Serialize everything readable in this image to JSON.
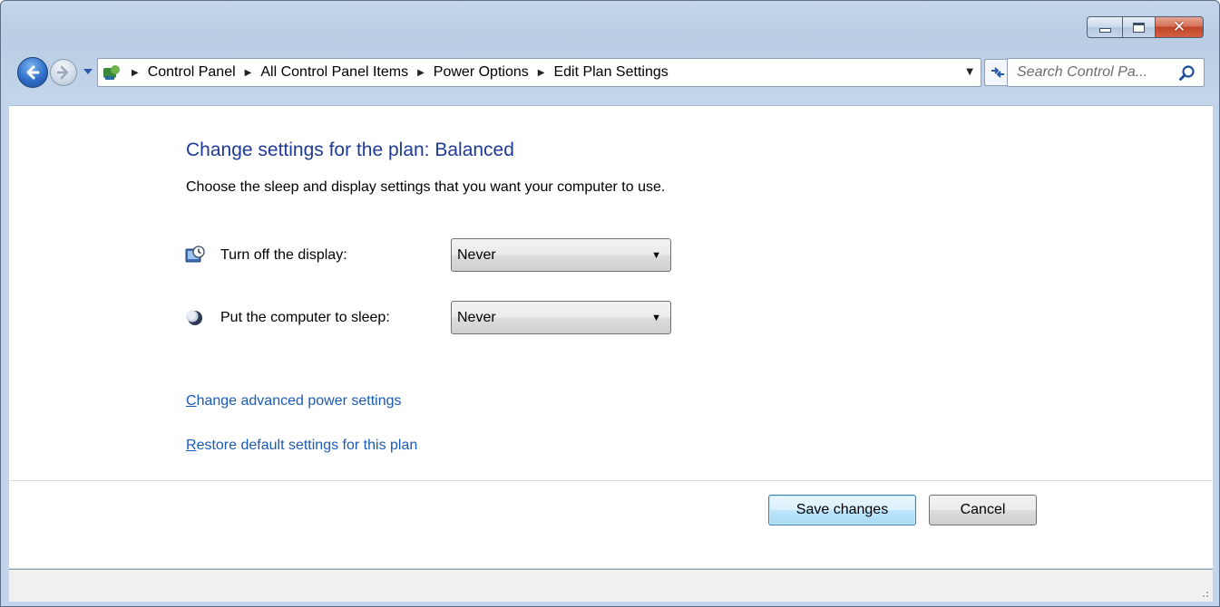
{
  "window": {
    "caption": {
      "minimize_label": "Minimize",
      "maximize_label": "Maximize",
      "close_label": "Close"
    }
  },
  "navbar": {
    "back_icon": "back-arrow-icon",
    "forward_icon": "forward-arrow-icon",
    "breadcrumbs": [
      "Control Panel",
      "All Control Panel Items",
      "Power Options",
      "Edit Plan Settings"
    ],
    "search_placeholder": "Search Control Pa..."
  },
  "main": {
    "title": "Change settings for the plan: Balanced",
    "description": "Choose the sleep and display settings that you want your computer to use.",
    "settings": [
      {
        "label": "Turn off the display:",
        "value": "Never",
        "icon": "display-timer-icon"
      },
      {
        "label": "Put the computer to sleep:",
        "value": "Never",
        "icon": "sleep-moon-icon"
      }
    ],
    "links": {
      "advanced_first": "C",
      "advanced_rest": "hange advanced power settings",
      "restore_first": "R",
      "restore_rest": "estore default settings for this plan"
    },
    "buttons": {
      "save": "Save changes",
      "cancel": "Cancel"
    }
  },
  "colors": {
    "title_blue": "#1e3a96",
    "link_blue": "#1a5bb5",
    "frame": "#c3d5ea"
  }
}
